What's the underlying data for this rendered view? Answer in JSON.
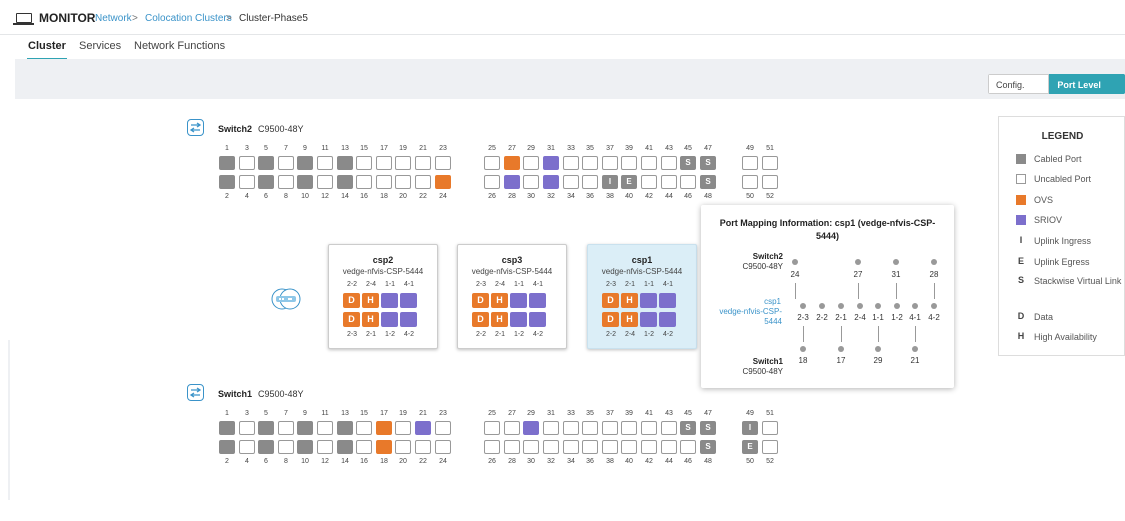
{
  "header": {
    "app_title": "MONITOR",
    "breadcrumb": {
      "network": "Network",
      "sep1": ">",
      "clusters": "Colocation Clusters",
      "sep2": ">",
      "current": "Cluster-Phase5"
    }
  },
  "tabs": [
    {
      "label": "Cluster"
    },
    {
      "label": "Services"
    },
    {
      "label": "Network Functions"
    }
  ],
  "view_toggle": {
    "config": "Config. View",
    "port_level": "Port Level View",
    "active": "Port Level View"
  },
  "switch2": {
    "name": "Switch2",
    "model": "C9500-48Y",
    "top_numbers": [
      "1",
      "3",
      "5",
      "7",
      "9",
      "11",
      "13",
      "15",
      "17",
      "19",
      "21",
      "23",
      "25",
      "27",
      "29",
      "31",
      "33",
      "35",
      "37",
      "39",
      "41",
      "43",
      "45",
      "47",
      "49",
      "51"
    ],
    "bottom_numbers": [
      "2",
      "4",
      "6",
      "8",
      "10",
      "12",
      "14",
      "16",
      "18",
      "20",
      "22",
      "24",
      "26",
      "28",
      "30",
      "32",
      "34",
      "36",
      "38",
      "40",
      "42",
      "44",
      "46",
      "48",
      "50",
      "52"
    ],
    "top_states": [
      "cab",
      "",
      "cab",
      "",
      "cab",
      "",
      "cab",
      "",
      "",
      "",
      "",
      "",
      "",
      "ovs",
      "",
      "sriov",
      "",
      "",
      "",
      "",
      "",
      "",
      "S",
      "S",
      "",
      ""
    ],
    "bottom_states": [
      "cab",
      "",
      "cab",
      "",
      "cab",
      "",
      "cab",
      "",
      "",
      "",
      "",
      "ovs",
      "",
      "sriov",
      "",
      "sriov",
      "",
      "",
      "I",
      "E",
      "",
      "",
      "",
      "S",
      "",
      ""
    ]
  },
  "switch1": {
    "name": "Switch1",
    "model": "C9500-48Y",
    "top_numbers": [
      "1",
      "3",
      "5",
      "7",
      "9",
      "11",
      "13",
      "15",
      "17",
      "19",
      "21",
      "23",
      "25",
      "27",
      "29",
      "31",
      "33",
      "35",
      "37",
      "39",
      "41",
      "43",
      "45",
      "47",
      "49",
      "51"
    ],
    "bottom_numbers": [
      "2",
      "4",
      "6",
      "8",
      "10",
      "12",
      "14",
      "16",
      "18",
      "20",
      "22",
      "24",
      "26",
      "28",
      "30",
      "32",
      "34",
      "36",
      "38",
      "40",
      "42",
      "44",
      "46",
      "48",
      "50",
      "52"
    ],
    "top_states": [
      "cab",
      "",
      "cab",
      "",
      "cab",
      "",
      "cab",
      "",
      "ovs",
      "",
      "sriov",
      "",
      "",
      "",
      "sriov",
      "",
      "",
      "",
      "",
      "",
      "",
      "",
      "S",
      "S",
      "I",
      ""
    ],
    "bottom_states": [
      "cab",
      "",
      "cab",
      "",
      "cab",
      "",
      "cab",
      "",
      "ovs",
      "",
      "",
      "",
      "",
      "",
      "",
      "",
      "",
      "",
      "",
      "",
      "",
      "",
      "",
      "S",
      "E",
      ""
    ]
  },
  "csps": [
    {
      "title": "csp2",
      "host": "vedge-nfvis-CSP-5444",
      "top_labels": [
        "2-2",
        "2-4",
        "1-1",
        "4-1"
      ],
      "bottom_labels": [
        "2-3",
        "2-1",
        "1-2",
        "4-2"
      ],
      "top_ports": [
        {
          "type": "ovs",
          "letter": "D"
        },
        {
          "type": "ovs",
          "letter": "H"
        },
        {
          "type": "sriov",
          "letter": ""
        },
        {
          "type": "sriov",
          "letter": ""
        }
      ],
      "bottom_ports": [
        {
          "type": "ovs",
          "letter": "D"
        },
        {
          "type": "ovs",
          "letter": "H"
        },
        {
          "type": "sriov",
          "letter": ""
        },
        {
          "type": "sriov",
          "letter": ""
        }
      ]
    },
    {
      "title": "csp3",
      "host": "vedge-nfvis-CSP-5444",
      "top_labels": [
        "2-3",
        "2-4",
        "1-1",
        "4-1"
      ],
      "bottom_labels": [
        "2-2",
        "2-1",
        "1-2",
        "4-2"
      ],
      "top_ports": [
        {
          "type": "ovs",
          "letter": "D"
        },
        {
          "type": "ovs",
          "letter": "H"
        },
        {
          "type": "sriov",
          "letter": ""
        },
        {
          "type": "sriov",
          "letter": ""
        }
      ],
      "bottom_ports": [
        {
          "type": "ovs",
          "letter": "D"
        },
        {
          "type": "ovs",
          "letter": "H"
        },
        {
          "type": "sriov",
          "letter": ""
        },
        {
          "type": "sriov",
          "letter": ""
        }
      ]
    },
    {
      "title": "csp1",
      "host": "vedge-nfvis-CSP-5444",
      "top_labels": [
        "2-3",
        "2-1",
        "1-1",
        "4-1"
      ],
      "bottom_labels": [
        "2-2",
        "2-4",
        "1-2",
        "4-2"
      ],
      "top_ports": [
        {
          "type": "ovs",
          "letter": "D"
        },
        {
          "type": "ovs",
          "letter": "H"
        },
        {
          "type": "sriov",
          "letter": ""
        },
        {
          "type": "sriov",
          "letter": ""
        }
      ],
      "bottom_ports": [
        {
          "type": "ovs",
          "letter": "D"
        },
        {
          "type": "ovs",
          "letter": "H"
        },
        {
          "type": "sriov",
          "letter": ""
        },
        {
          "type": "sriov",
          "letter": ""
        }
      ]
    }
  ],
  "legend": {
    "title": "LEGEND",
    "items": [
      {
        "kind": "swatch",
        "color": "#8a8a8a",
        "label": "Cabled Port"
      },
      {
        "kind": "swatch",
        "color": "#ffffff",
        "label": "Uncabled Port"
      },
      {
        "kind": "swatch",
        "color": "#e8792a",
        "label": "OVS"
      },
      {
        "kind": "swatch",
        "color": "#7c6fcc",
        "label": "SRIOV"
      },
      {
        "kind": "letter",
        "letter": "I",
        "label": "Uplink Ingress"
      },
      {
        "kind": "letter",
        "letter": "E",
        "label": "Uplink Egress"
      },
      {
        "kind": "letter",
        "letter": "S",
        "label": "Stackwise Virtual Link"
      },
      {
        "kind": "letter",
        "letter": "D",
        "label": "Data"
      },
      {
        "kind": "letter",
        "letter": "H",
        "label": "High Availability"
      }
    ]
  },
  "mapping": {
    "title": "Port Mapping Information: csp1 (vedge-nfvis-CSP-5444)",
    "switch2": {
      "name": "Switch2",
      "model": "C9500-48Y",
      "ports": [
        "24",
        "27",
        "31",
        "28"
      ]
    },
    "csp": {
      "name": "csp1",
      "host": "vedge-nfvis-CSP-5444",
      "ports": [
        "2-3",
        "2-2",
        "2-1",
        "2-4",
        "1-1",
        "1-2",
        "4-1",
        "4-2"
      ]
    },
    "switch1": {
      "name": "Switch1",
      "model": "C9500-48Y",
      "ports": [
        "18",
        "17",
        "29",
        "21"
      ]
    }
  }
}
